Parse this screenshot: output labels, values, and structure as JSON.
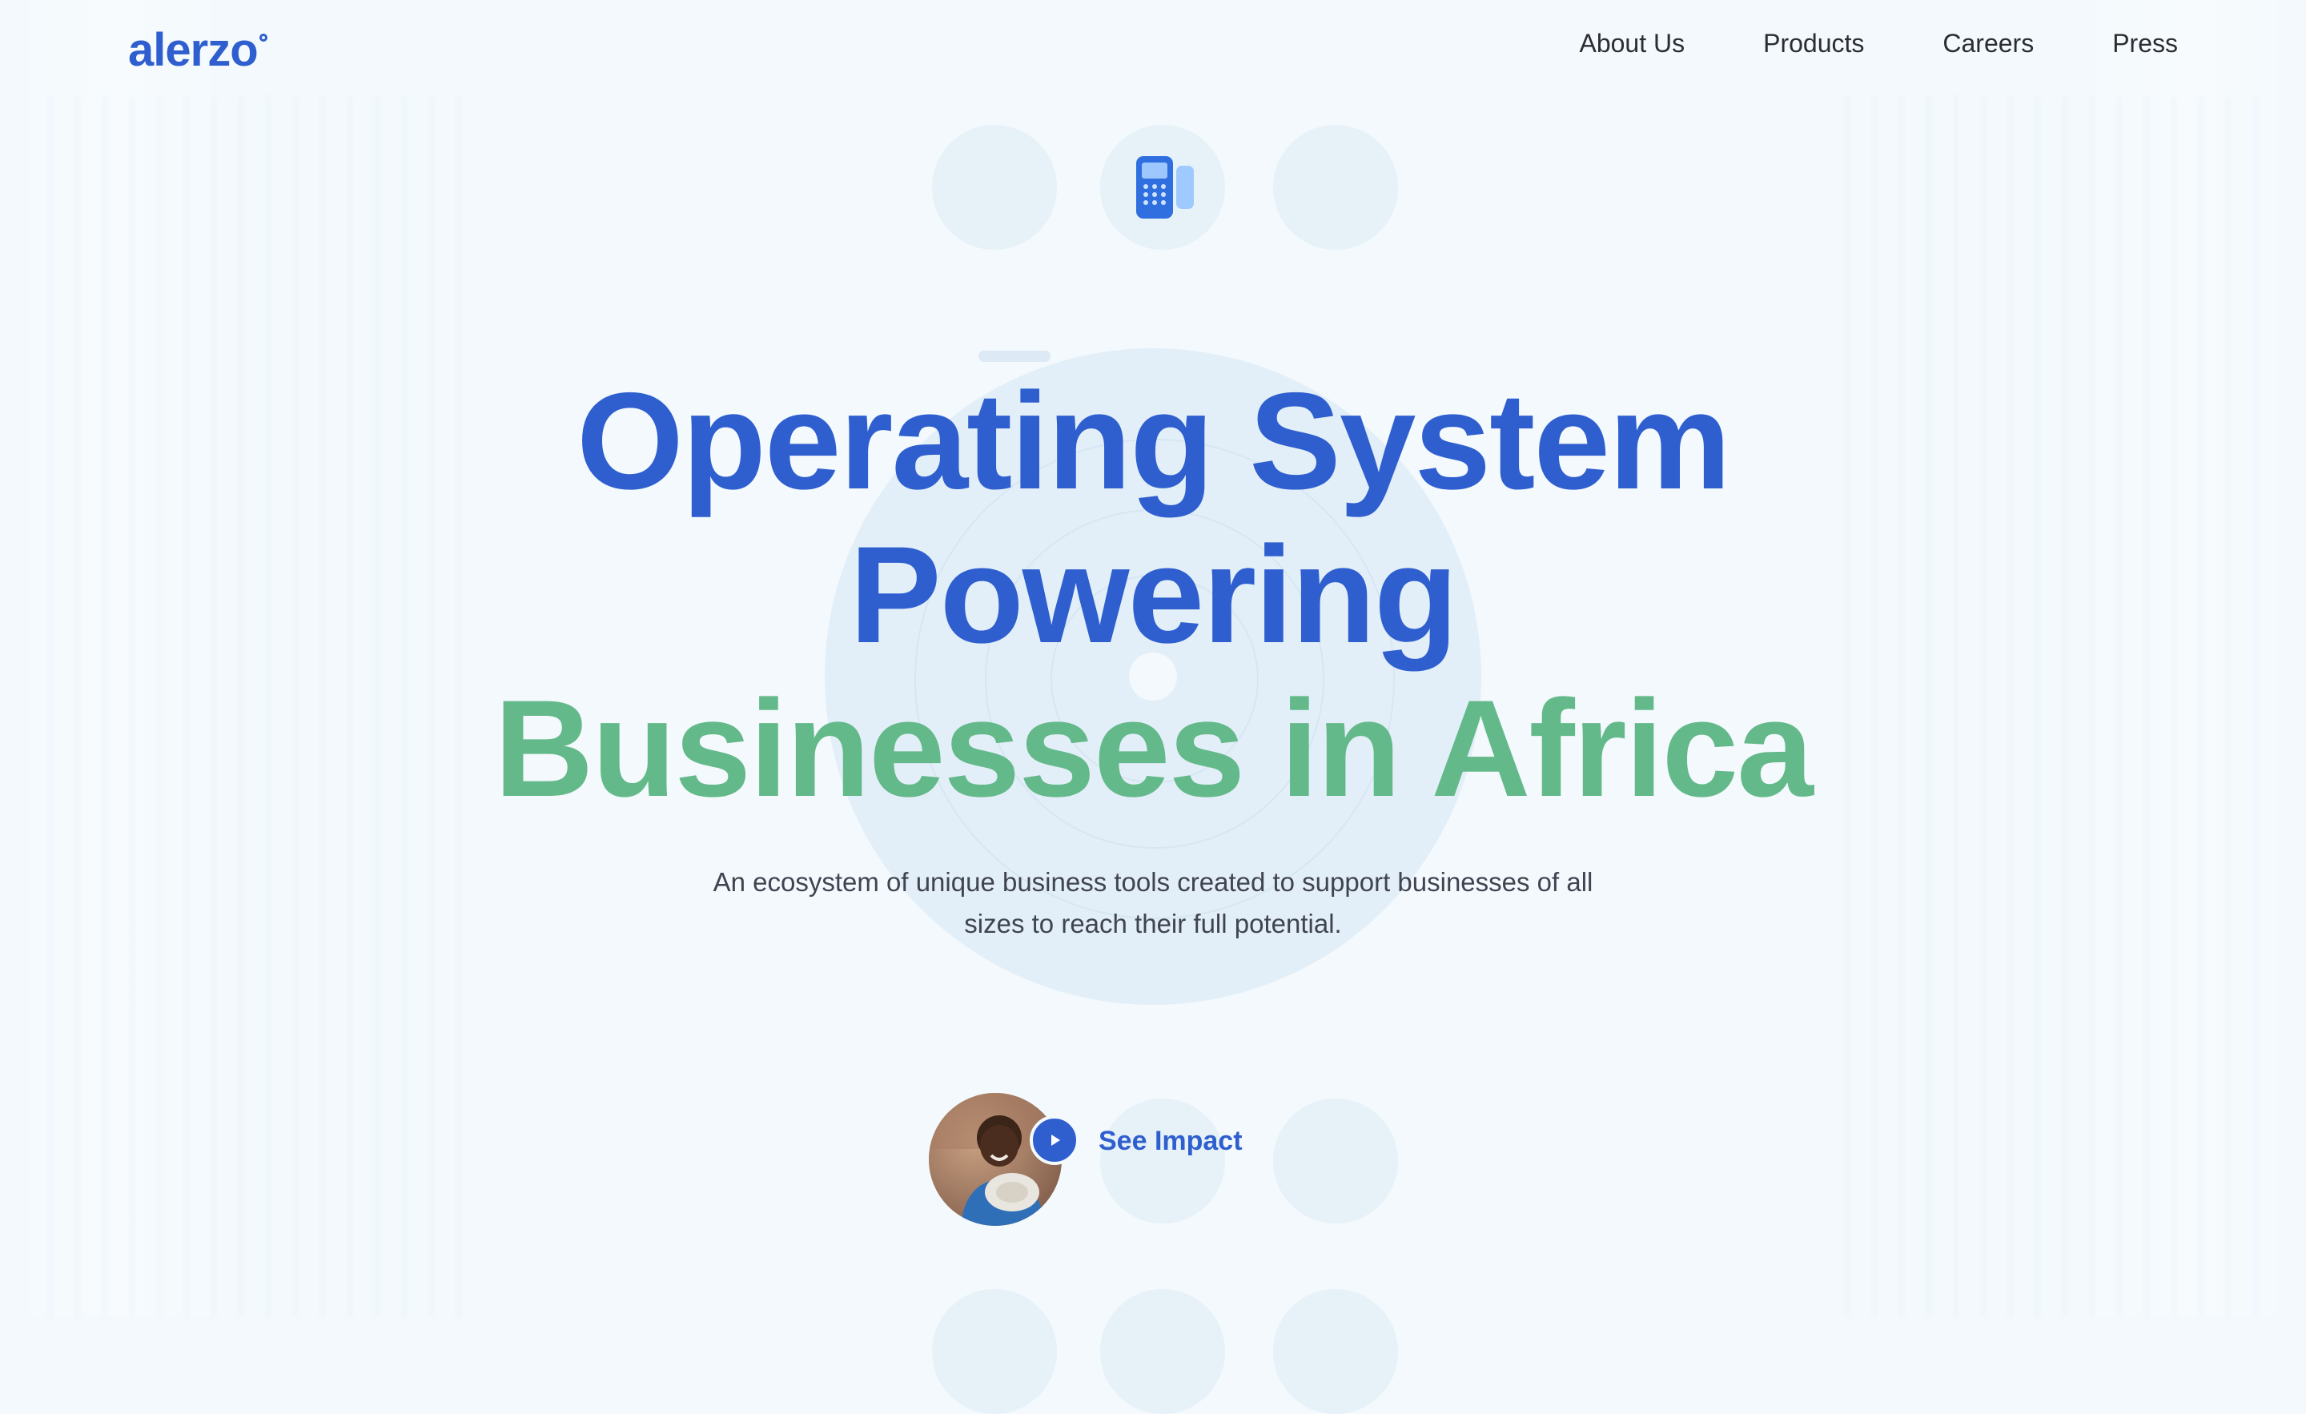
{
  "brand": {
    "name": "alerzo",
    "colors": {
      "primary_blue": "#2f5fcf",
      "accent_green": "#64b98a",
      "background": "#f3f9fd"
    }
  },
  "nav": {
    "items": [
      {
        "label": "About Us"
      },
      {
        "label": "Products"
      },
      {
        "label": "Careers"
      },
      {
        "label": "Press"
      }
    ]
  },
  "hero": {
    "line1": "Operating System",
    "line2": "Powering",
    "line3": "Businesses in Africa",
    "subtitle_line1": "An ecosystem of unique business tools created to support businesses of all",
    "subtitle_line2": "sizes to reach their full potential."
  },
  "cta": {
    "see_impact_label": "See Impact",
    "play_icon": "play-icon"
  },
  "icons": {
    "pos_terminal": "pos-terminal-icon"
  }
}
